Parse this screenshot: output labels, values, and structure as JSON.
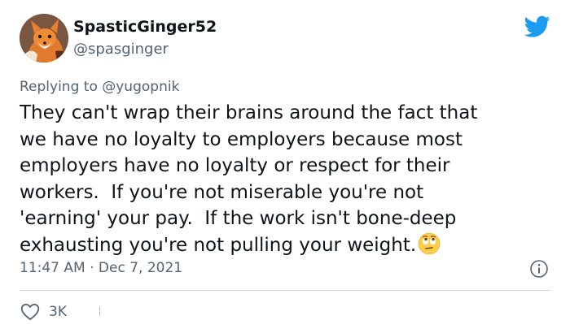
{
  "user": {
    "display_name": "SpasticGinger52",
    "handle": "@spasginger",
    "avatar_icon": "fox-avatar"
  },
  "brand": {
    "icon": "twitter-bird-icon",
    "color": "#1d9bf0"
  },
  "reply": {
    "prefix": "Replying to ",
    "mention": "@yugopnik"
  },
  "tweet": {
    "lines": [
      "They can't wrap their brains around the fact that",
      "we have no loyalty to employers because most",
      "employers have no loyalty or respect for their",
      "workers.  If you're not miserable you're not",
      "'earning' your pay.  If the work isn't bone-deep",
      "exhausting you're not pulling your weight."
    ],
    "emoji": "face-with-rolling-eyes-icon"
  },
  "meta": {
    "timestamp": "11:47 AM · Dec 7, 2021",
    "info_icon": "info-icon"
  },
  "actions": {
    "like_icon": "heart-icon",
    "like_count": "3K"
  },
  "colors": {
    "text": "#0f1419",
    "secondary": "#536471",
    "divider": "#cfd9de"
  }
}
